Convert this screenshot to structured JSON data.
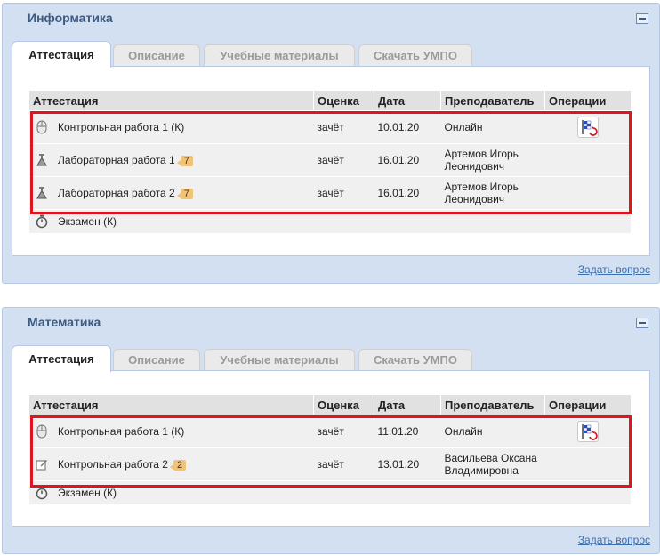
{
  "panels": [
    {
      "title": "Информатика",
      "tabs": [
        "Аттестация",
        "Описание",
        "Учебные материалы",
        "Скачать УМПО"
      ],
      "columns": [
        "Аттестация",
        "Оценка",
        "Дата",
        "Преподаватель",
        "Операции"
      ],
      "rows": [
        {
          "icon": "mouse-icon",
          "name": "Контрольная работа 1 (К)",
          "badge": "",
          "grade": "зачёт",
          "date": "10.01.20",
          "teacher": "Онлайн",
          "op": true
        },
        {
          "icon": "flask-icon",
          "name": "Лабораторная работа 1",
          "badge": "7",
          "grade": "зачёт",
          "date": "16.01.20",
          "teacher": "Артемов Игорь Леонидович",
          "op": false
        },
        {
          "icon": "flask-icon",
          "name": "Лабораторная работа 2",
          "badge": "7",
          "grade": "зачёт",
          "date": "16.01.20",
          "teacher": "Артемов Игорь Леонидович",
          "op": false
        }
      ],
      "exam": {
        "icon": "stopwatch-icon",
        "name": "Экзамен (К)"
      },
      "ask_link": "Задать вопрос"
    },
    {
      "title": "Математика",
      "tabs": [
        "Аттестация",
        "Описание",
        "Учебные материалы",
        "Скачать УМПО"
      ],
      "columns": [
        "Аттестация",
        "Оценка",
        "Дата",
        "Преподаватель",
        "Операции"
      ],
      "rows": [
        {
          "icon": "mouse-icon",
          "name": "Контрольная работа 1 (К)",
          "badge": "",
          "grade": "зачёт",
          "date": "11.01.20",
          "teacher": "Онлайн",
          "op": true
        },
        {
          "icon": "edit-icon",
          "name": "Контрольная работа 2",
          "badge": "2",
          "grade": "зачёт",
          "date": "13.01.20",
          "teacher": "Васильева Оксана Владимировна",
          "op": false
        }
      ],
      "exam": {
        "icon": "stopwatch-icon",
        "name": "Экзамен (К)"
      },
      "ask_link": "Задать вопрос"
    }
  ],
  "colors": {
    "panel_bg": "#d3e0f1",
    "title": "#3d5a80",
    "highlight": "#e0141e",
    "link": "#3a6fb0",
    "badge": "#f0c27a"
  }
}
